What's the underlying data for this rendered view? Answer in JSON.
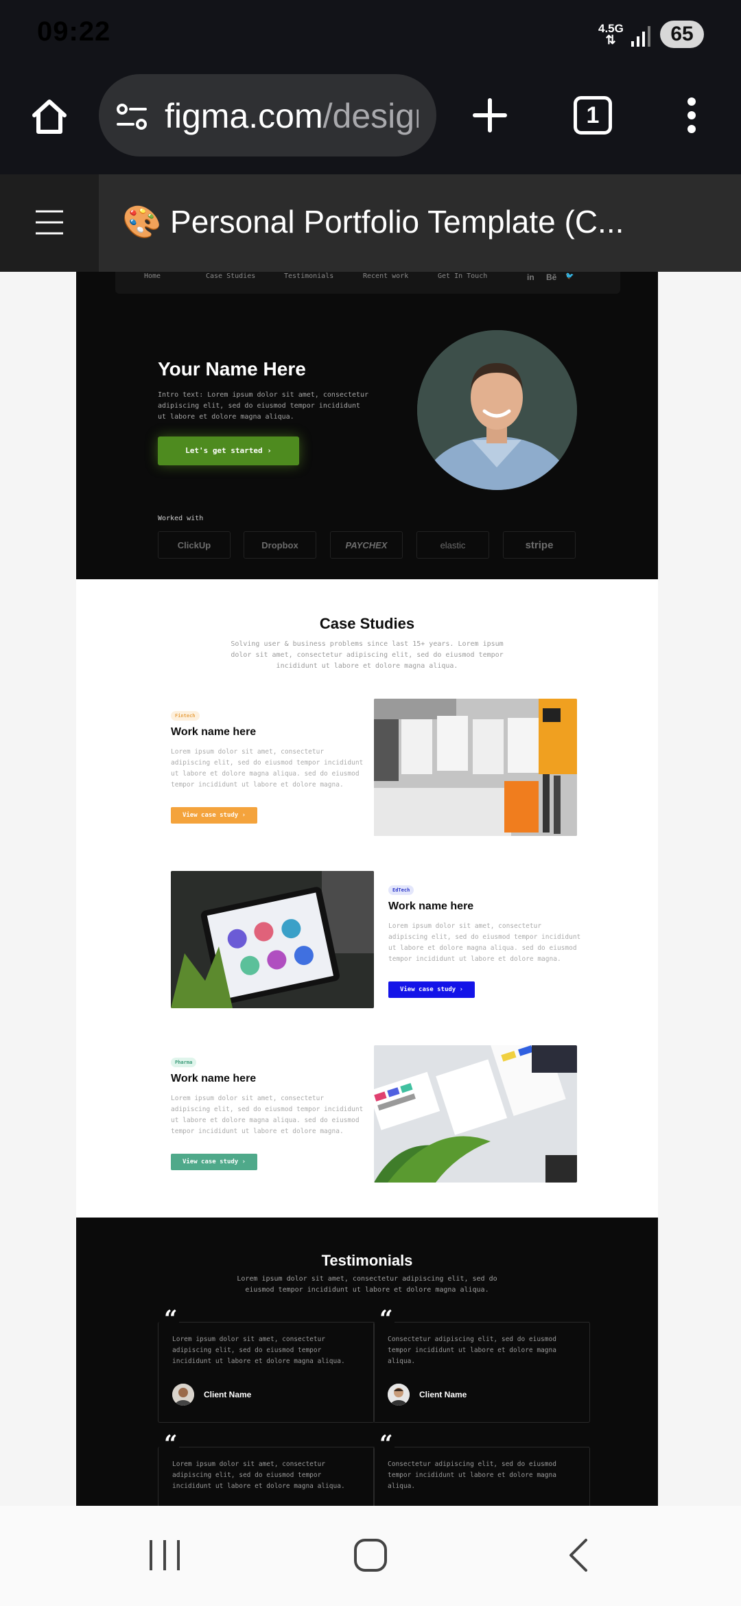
{
  "status_bar": {
    "time": "09:22",
    "network": "4.5G",
    "battery": "65"
  },
  "browser": {
    "url": "figma.com/design",
    "tab_count": "1"
  },
  "figma": {
    "title": "🎨 Personal Portfolio Template (C..."
  },
  "site": {
    "nav": {
      "links": [
        "Home",
        "Case Studies",
        "Testimonials",
        "Recent work",
        "Get In Touch"
      ],
      "social": [
        "in",
        "Bē",
        "🐦"
      ]
    },
    "hero": {
      "title": "Your Name Here",
      "intro": "Intro text: Lorem ipsum dolor sit amet, consectetur adipiscing elit, sed do eiusmod tempor incididunt ut labore et dolore magna aliqua.",
      "cta": "Let's get started ›",
      "worked_with": "Worked with",
      "logos": [
        "ClickUp",
        "Dropbox",
        "PAYCHEX",
        "elastic",
        "stripe"
      ]
    },
    "case_studies": {
      "title": "Case Studies",
      "subtitle": "Solving user & business problems since last 15+ years. Lorem ipsum dolor sit amet, consectetur adipiscing elit, sed do eiusmod tempor incididunt ut labore et dolore magna aliqua.",
      "items": [
        {
          "tag": "Fintech",
          "title": "Work name here",
          "desc": "Lorem ipsum dolor sit amet, consectetur adipiscing elit, sed do eiusmod tempor incididunt ut labore et dolore magna aliqua. sed do eiusmod tempor incididunt ut labore et dolore magna.",
          "button": "View case study ›",
          "accent": "#f4a33c"
        },
        {
          "tag": "EdTech",
          "title": "Work name here",
          "desc": "Lorem ipsum dolor sit amet, consectetur adipiscing elit, sed do eiusmod tempor incididunt ut labore et dolore magna aliqua. sed do eiusmod tempor incididunt ut labore et dolore magna.",
          "button": "View case study ›",
          "accent": "#1414e8"
        },
        {
          "tag": "Pharma",
          "title": "Work name here",
          "desc": "Lorem ipsum dolor sit amet, consectetur adipiscing elit, sed do eiusmod tempor incididunt ut labore et dolore magna aliqua. sed do eiusmod tempor incididunt ut labore et dolore magna.",
          "button": "View case study ›",
          "accent": "#4fa98a"
        }
      ]
    },
    "testimonials": {
      "title": "Testimonials",
      "subtitle": "Lorem ipsum dolor sit amet, consectetur adipiscing elit, sed do eiusmod tempor incididunt ut labore et dolore magna aliqua.",
      "items": [
        {
          "text": "Lorem ipsum dolor sit amet, consectetur adipiscing elit, sed do eiusmod tempor incididunt ut labore et dolore magna aliqua.",
          "name": "Client Name"
        },
        {
          "text": "Consectetur adipiscing elit, sed do eiusmod tempor incididunt ut labore et dolore magna aliqua.",
          "name": "Client Name"
        },
        {
          "text": "Lorem ipsum dolor sit amet, consectetur adipiscing elit, sed do eiusmod tempor incididunt ut labore et dolore magna aliqua.",
          "name": ""
        },
        {
          "text": "Consectetur adipiscing elit, sed do eiusmod tempor incididunt ut labore et dolore magna aliqua.",
          "name": ""
        }
      ]
    }
  },
  "icons": {
    "home": "home-icon",
    "site_settings": "site-settings-icon",
    "new_tab": "plus-icon",
    "tabs": "tab-switcher-icon",
    "menu": "more-vert-icon",
    "hamburger": "hamburger-icon"
  },
  "colors": {
    "hero_bg": "#0b0b0b",
    "hero_cta": "#4e8b1f",
    "browser_bg": "#121318",
    "figma_bar": "#2c2c2c"
  }
}
